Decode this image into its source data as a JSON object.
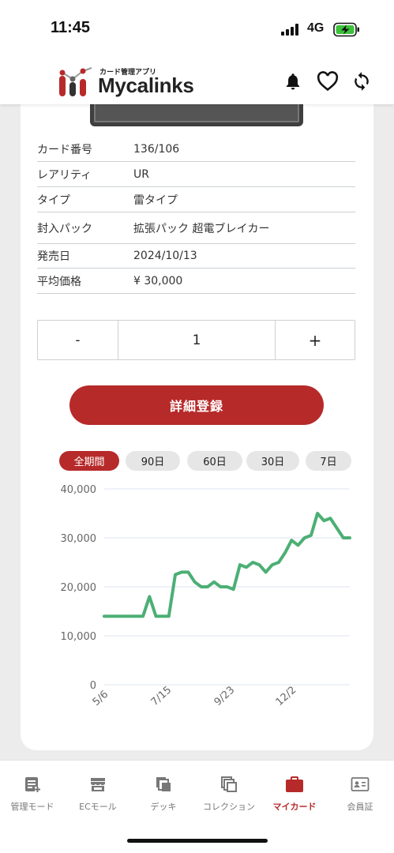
{
  "status": {
    "time": "11:45",
    "network": "4G"
  },
  "app": {
    "logo_sub": "カード管理アプリ",
    "logo_text": "Mycalinks"
  },
  "details": [
    {
      "key": "カード番号",
      "value": "136/106"
    },
    {
      "key": "レアリティ",
      "value": "UR"
    },
    {
      "key": "タイプ",
      "value": "雷タイプ"
    },
    {
      "key": "封入パック",
      "value": "拡張パック 超電ブレイカー"
    },
    {
      "key": "発売日",
      "value": "2024/10/13"
    },
    {
      "key": "平均価格",
      "value": "¥ 30,000"
    }
  ],
  "quantity": {
    "minus": "-",
    "value": "1",
    "plus": "+"
  },
  "register_label": "詳細登録",
  "periods": [
    {
      "label": "全期間",
      "active": true
    },
    {
      "label": "90日",
      "active": false
    },
    {
      "label": "60日",
      "active": false
    },
    {
      "label": "30日",
      "active": false
    },
    {
      "label": "7日",
      "active": false
    }
  ],
  "colors": {
    "accent": "#b72a2a",
    "line": "#4caf75",
    "grid": "#dde3f0"
  },
  "chart_data": {
    "type": "line",
    "title": "",
    "xlabel": "",
    "ylabel": "",
    "ylim": [
      0,
      40000
    ],
    "yticks": [
      0,
      10000,
      20000,
      30000,
      40000
    ],
    "ytick_labels": [
      "0",
      "10,000",
      "20,000",
      "30,000",
      "40,000"
    ],
    "xtick_labels": [
      "5/6",
      "7/15",
      "9/23",
      "12/2"
    ],
    "grid": true,
    "series": [
      {
        "x": [
          "5/6",
          "6/1",
          "7/1",
          "7/15",
          "8/1",
          "9/1",
          "9/4",
          "9/5",
          "9/6",
          "9/23",
          "10/13",
          "10/15",
          "10/20",
          "10/24",
          "10/28",
          "11/1",
          "11/5",
          "11/10",
          "11/15",
          "11/20",
          "11/25",
          "12/2",
          "12/6",
          "12/10",
          "12/14",
          "12/18",
          "12/22",
          "12/26",
          "12/30",
          "1/3",
          "1/7",
          "1/10",
          "1/14",
          "1/18",
          "1/21",
          "1/24",
          "1/27",
          "1/30",
          "2/2"
        ],
        "y": [
          14000,
          14000,
          14000,
          14000,
          14000,
          14000,
          14000,
          18000,
          14000,
          14000,
          14000,
          22500,
          23000,
          23000,
          21000,
          20000,
          20000,
          21000,
          20000,
          20000,
          19500,
          24500,
          24000,
          25000,
          24500,
          23000,
          24500,
          25000,
          27000,
          29500,
          28500,
          30000,
          30500,
          35000,
          33500,
          34000,
          32000,
          30000,
          30000
        ]
      }
    ]
  },
  "tabs": [
    {
      "label": "管理モード",
      "icon": "manage-icon",
      "active": false
    },
    {
      "label": "ECモール",
      "icon": "store-icon",
      "active": false
    },
    {
      "label": "デッキ",
      "icon": "deck-icon",
      "active": false
    },
    {
      "label": "コレクション",
      "icon": "collection-icon",
      "active": false
    },
    {
      "label": "マイカード",
      "icon": "briefcase-icon",
      "active": true
    },
    {
      "label": "会員証",
      "icon": "member-card-icon",
      "active": false
    }
  ]
}
